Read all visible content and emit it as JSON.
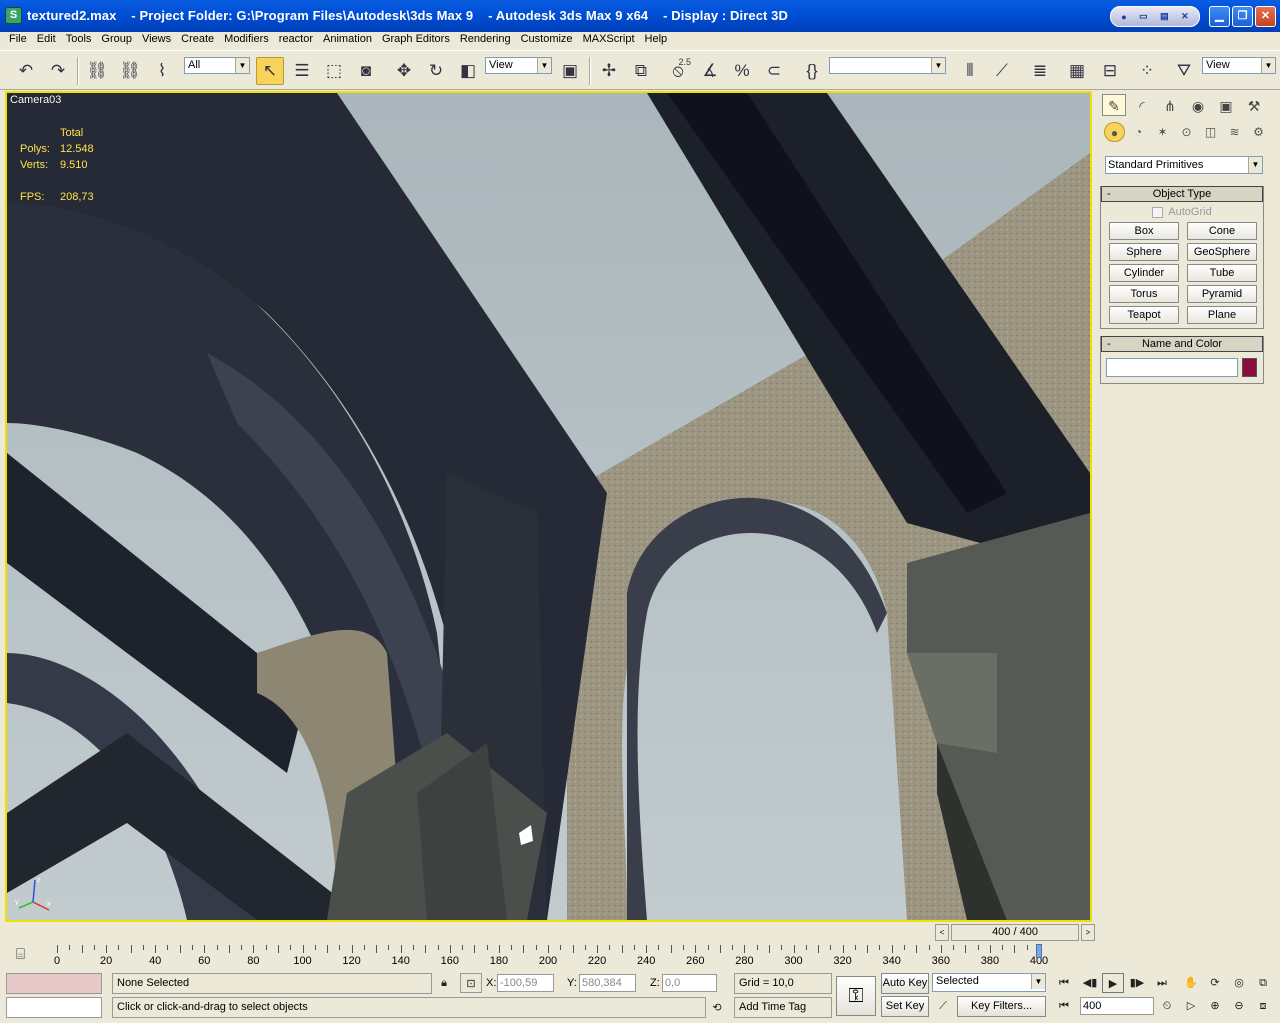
{
  "title": {
    "text": "textured2.max    - Project Folder: G:\\Program Files\\Autodesk\\3ds Max 9    - Autodesk 3ds Max 9 x64    - Display : Direct 3D"
  },
  "menu": [
    "File",
    "Edit",
    "Tools",
    "Group",
    "Views",
    "Create",
    "Modifiers",
    "reactor",
    "Animation",
    "Graph Editors",
    "Rendering",
    "Customize",
    "MAXScript",
    "Help"
  ],
  "toolbar": {
    "selection_filter": "All",
    "ref_coord": "View",
    "snap_value": "2.5",
    "named_selection": "",
    "render_view": "View"
  },
  "viewport": {
    "label": "Camera03",
    "stats": {
      "header": "Total",
      "polys_label": "Polys:",
      "polys": "12.548",
      "verts_label": "Verts:",
      "verts": "9.510",
      "fps_label": "FPS:",
      "fps": "208,73"
    },
    "axis": {
      "x": "x",
      "y": "y",
      "z": "z"
    }
  },
  "command_panel": {
    "category": "Standard Primitives",
    "object_type": {
      "title": "Object Type",
      "autogrid": "AutoGrid",
      "buttons": [
        "Box",
        "Cone",
        "Sphere",
        "GeoSphere",
        "Cylinder",
        "Tube",
        "Torus",
        "Pyramid",
        "Teapot",
        "Plane"
      ]
    },
    "name_color": {
      "title": "Name and Color",
      "color": "#8b0f3a"
    }
  },
  "time_slider": {
    "label": "400 / 400",
    "current_frame": 400,
    "frame_max": 400
  },
  "track": {
    "labels": [
      "0",
      "20",
      "40",
      "60",
      "80",
      "100",
      "120",
      "140",
      "160",
      "180",
      "200",
      "220",
      "240",
      "260",
      "280",
      "300",
      "320",
      "340",
      "360",
      "380",
      "400"
    ]
  },
  "status": {
    "selection": "None Selected",
    "prompt": "Click or click-and-drag to select objects",
    "x_label": "X:",
    "x": "-100,59",
    "y_label": "Y:",
    "y": "580,384",
    "z_label": "Z:",
    "z": "0,0",
    "grid": "Grid = 10,0",
    "add_time_tag": "Add Time Tag",
    "auto_key": "Auto Key",
    "set_key": "Set Key",
    "key_mode": "Selected",
    "key_filters": "Key Filters...",
    "frame_field": "400"
  }
}
